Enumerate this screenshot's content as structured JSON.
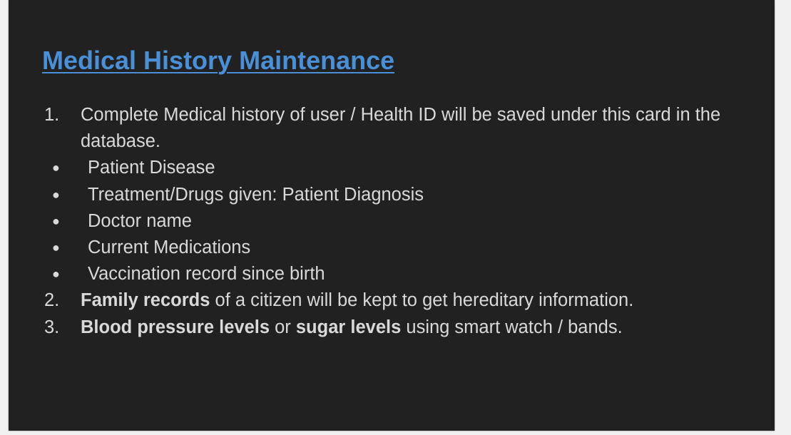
{
  "slide": {
    "title": "Medical History Maintenance",
    "colors": {
      "background": "#212121",
      "title": "#4a90d9",
      "text": "#d9d9d9"
    },
    "items": [
      {
        "number": "1.",
        "text": "Complete Medical history of user / Health ID will be saved under this card in the database.",
        "bullet_glyph": "●",
        "subitems": [
          "Patient Disease",
          "Treatment/Drugs given: Patient Diagnosis",
          "Doctor name",
          "Current Medications",
          "Vaccination record since birth"
        ]
      },
      {
        "number": "2.",
        "bold_1": "Family records",
        "rest": " of a citizen will be kept to get hereditary information."
      },
      {
        "number": "3.",
        "bold_1": "Blood pressure levels",
        "mid": " or ",
        "bold_2": "sugar levels",
        "rest": " using smart watch / bands."
      }
    ]
  }
}
